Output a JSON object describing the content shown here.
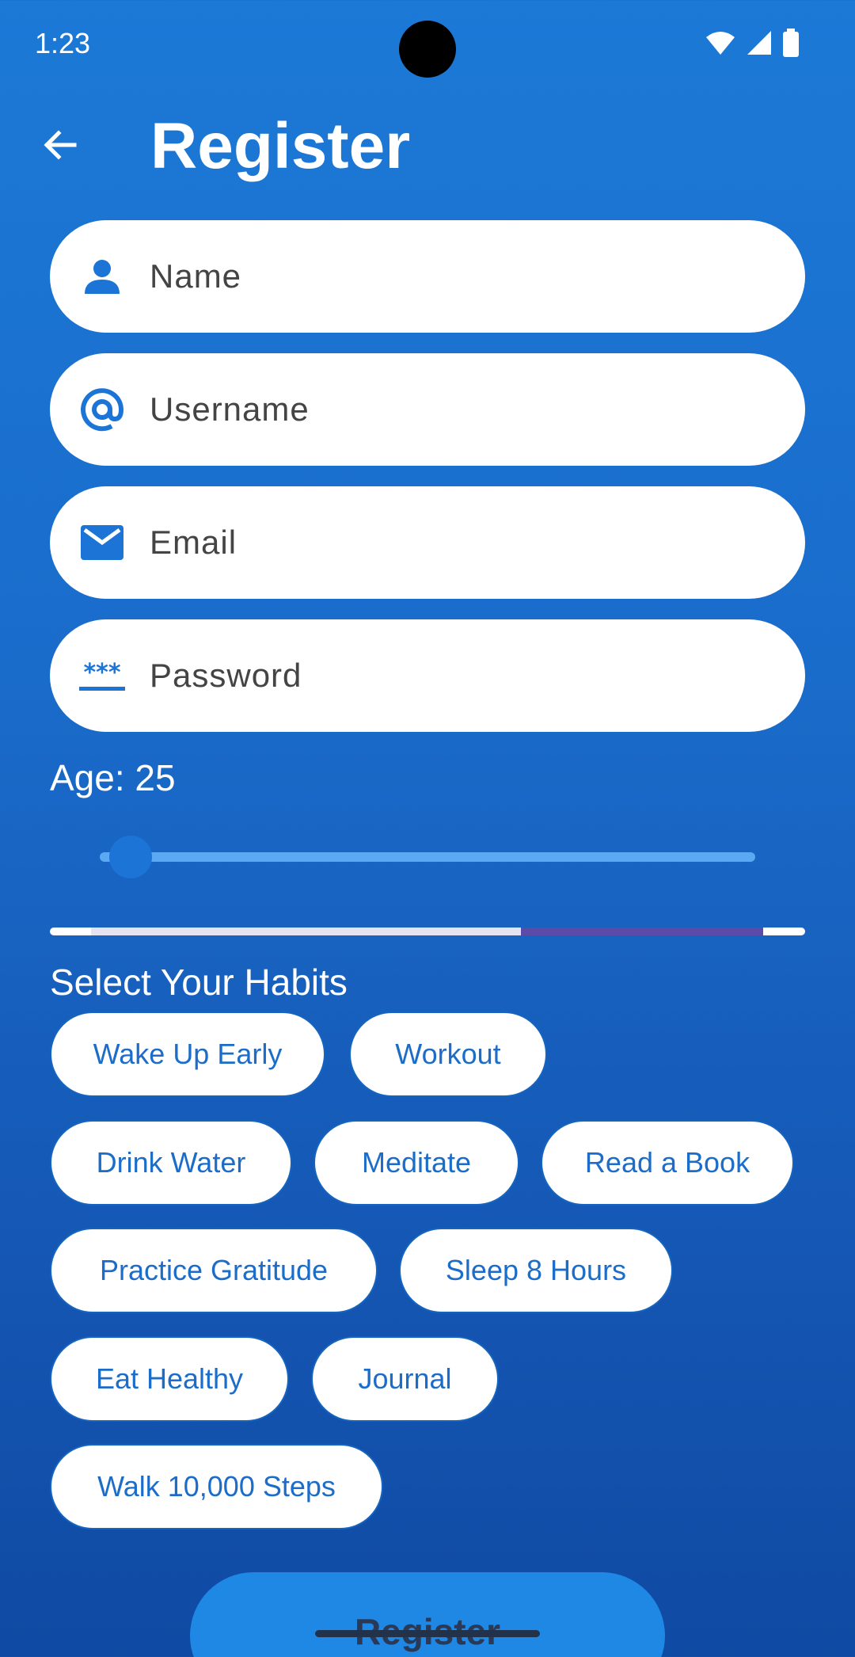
{
  "status_bar": {
    "time": "1:23"
  },
  "appbar": {
    "title": "Register"
  },
  "form": {
    "name_placeholder": "Name",
    "username_placeholder": "Username",
    "email_placeholder": "Email",
    "password_placeholder": "Password",
    "password_icon_glyph": "***"
  },
  "age": {
    "label": "Age: 25",
    "value": 25
  },
  "progress": {
    "segment_colors": [
      "#e3e3f1",
      "#5b4aa8"
    ]
  },
  "habits": {
    "title": "Select Your Habits",
    "items": [
      "Wake Up Early",
      "Workout",
      "Drink Water",
      "Meditate",
      "Read a Book",
      "Practice Gratitude",
      "Sleep 8 Hours",
      "Eat Healthy",
      "Journal",
      "Walk 10,000 Steps"
    ]
  },
  "register_button": {
    "label": "Register"
  },
  "colors": {
    "accent": "#1b74d6",
    "chip_text": "#1b6dc9",
    "background": "#1a6ccb"
  }
}
